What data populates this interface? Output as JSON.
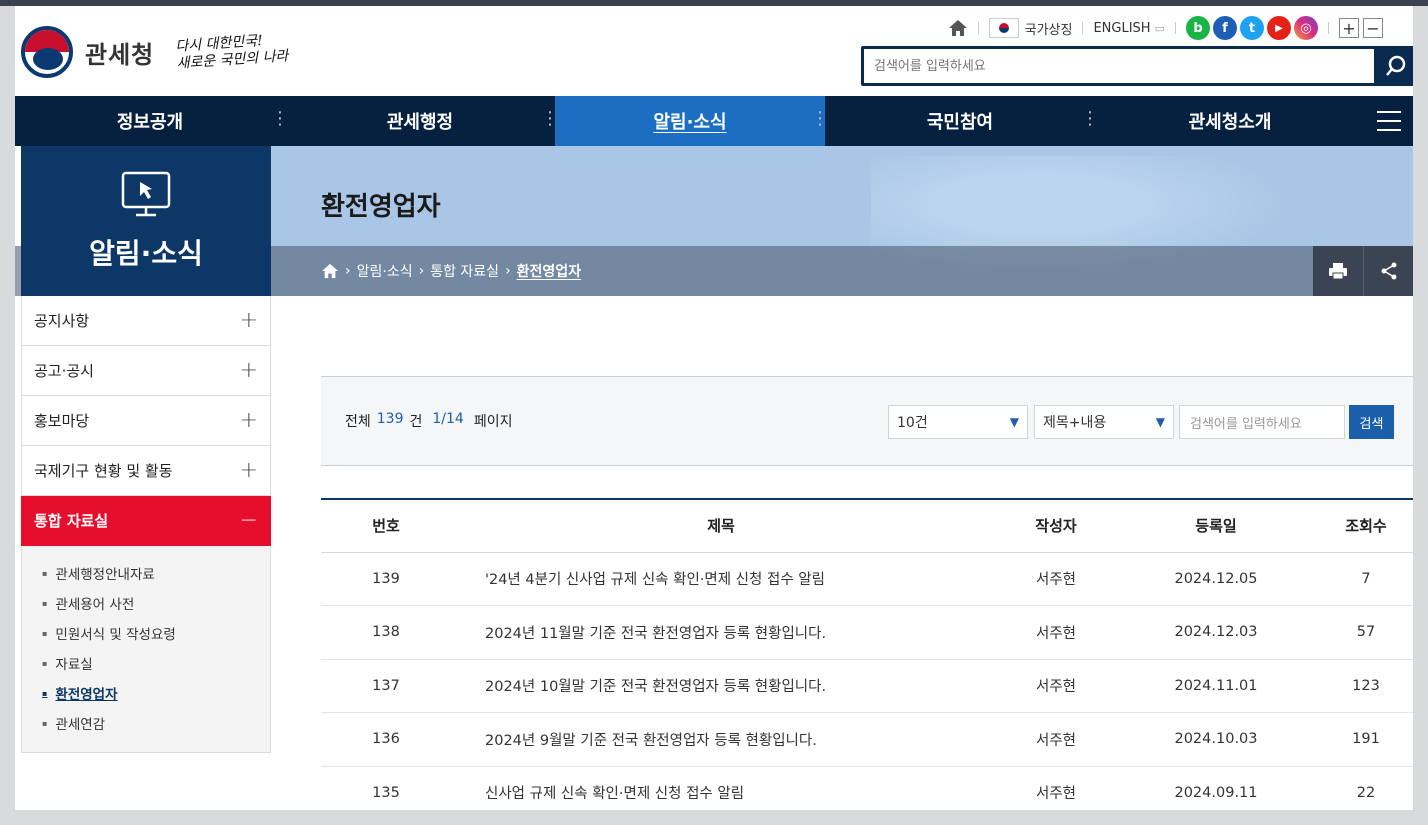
{
  "header": {
    "logo_text": "관세청",
    "slogan_line1": "다시 대한민국!",
    "slogan_line2": "새로운 국민의 나라",
    "util": {
      "symbol_label": "국가상징",
      "english_label": "ENGLISH"
    },
    "sns": [
      "b",
      "f",
      "t",
      "▶",
      "◎"
    ],
    "zoom": [
      "+",
      "−"
    ],
    "search_placeholder": "검색어를 입력하세요"
  },
  "gnb": [
    "정보공개",
    "관세행정",
    "알림·소식",
    "국민참여",
    "관세청소개"
  ],
  "side": {
    "title": "알림·소식",
    "menus": [
      {
        "label": "공지사항",
        "sign": "+"
      },
      {
        "label": "공고·공시",
        "sign": "+"
      },
      {
        "label": "홍보마당",
        "sign": "+"
      },
      {
        "label": "국제기구 현황 및 활동",
        "sign": "+"
      },
      {
        "label": "통합 자료실",
        "sign": "−"
      }
    ],
    "sub": [
      "관세행정안내자료",
      "관세용어 사전",
      "민원서식 및 작성요령",
      "자료실",
      "환전영업자",
      "관세연감"
    ]
  },
  "page": {
    "title": "환전영업자",
    "breadcrumb": [
      "알림·소식",
      "통합 자료실",
      "환전영업자"
    ]
  },
  "filter": {
    "total_label": "전체",
    "total_count": "139",
    "count_unit": "건",
    "page_info": "1/14",
    "page_label": "페이지",
    "page_size": "10건",
    "search_type": "제목+내용",
    "keyword_placeholder": "검색어를 입력하세요",
    "search_button": "검색"
  },
  "table": {
    "headers": [
      "번호",
      "제목",
      "작성자",
      "등록일",
      "조회수"
    ],
    "rows": [
      {
        "no": "139",
        "title": "'24년 4분기 신사업 규제 신속 확인·면제 신청 접수 알림",
        "author": "서주현",
        "date": "2024.12.05",
        "views": "7"
      },
      {
        "no": "138",
        "title": "2024년 11월말 기준 전국 환전영업자 등록 현황입니다.",
        "author": "서주현",
        "date": "2024.12.03",
        "views": "57"
      },
      {
        "no": "137",
        "title": "2024년 10월말 기준 전국 환전영업자 등록 현황입니다.",
        "author": "서주현",
        "date": "2024.11.01",
        "views": "123"
      },
      {
        "no": "136",
        "title": "2024년 9월말 기준 전국 환전영업자 등록 현황입니다.",
        "author": "서주현",
        "date": "2024.10.03",
        "views": "191"
      },
      {
        "no": "135",
        "title": "신사업 규제 신속 확인·면제 신청 접수 알림",
        "author": "서주현",
        "date": "2024.09.11",
        "views": "22"
      }
    ]
  }
}
